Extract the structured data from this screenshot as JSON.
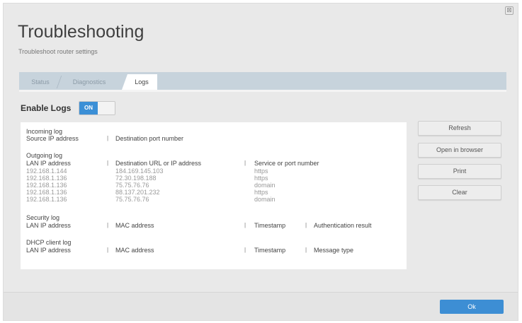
{
  "dialog": {
    "close_glyph": "⊠",
    "title": "Troubleshooting",
    "subtitle": "Troubleshoot router settings"
  },
  "tabs": [
    {
      "label": "Status"
    },
    {
      "label": "Diagnostics"
    },
    {
      "label": "Logs",
      "active": true
    }
  ],
  "enable_logs": {
    "label": "Enable Logs",
    "toggle_state": "ON"
  },
  "incoming": {
    "title": "Incoming log",
    "col_source": "Source IP address",
    "col_dest_port": "Destination port number"
  },
  "outgoing": {
    "title": "Outgoing log",
    "col_lan": "LAN IP address",
    "col_dest_url": "Destination URL or IP address",
    "col_service": "Service or port number",
    "rows": [
      {
        "lan": "192.168.1.144",
        "dest": "184.169.145.103",
        "service": "https"
      },
      {
        "lan": "192.168.1.136",
        "dest": "72.30.198.188",
        "service": "https"
      },
      {
        "lan": "192.168.1.136",
        "dest": "75.75.76.76",
        "service": "domain"
      },
      {
        "lan": "192.168.1.136",
        "dest": "88.137.201.232",
        "service": "https"
      },
      {
        "lan": "192.168.1.136",
        "dest": "75.75.76.76",
        "service": "domain"
      }
    ]
  },
  "security": {
    "title": "Security log",
    "col_lan": "LAN IP address",
    "col_mac": "MAC address",
    "col_time": "Timestamp",
    "col_auth": "Authentication result"
  },
  "dhcp": {
    "title": "DHCP client log",
    "col_lan": "LAN IP address",
    "col_mac": "MAC address",
    "col_time": "Timestamp",
    "col_type": "Message type"
  },
  "separator": "|",
  "actions": {
    "refresh": "Refresh",
    "open_browser": "Open in browser",
    "print": "Print",
    "clear": "Clear"
  },
  "footer": {
    "ok": "Ok"
  },
  "colors": {
    "accent": "#3d8ed4",
    "tabbar": "#c7d3dc",
    "background": "#e9e9e9"
  }
}
